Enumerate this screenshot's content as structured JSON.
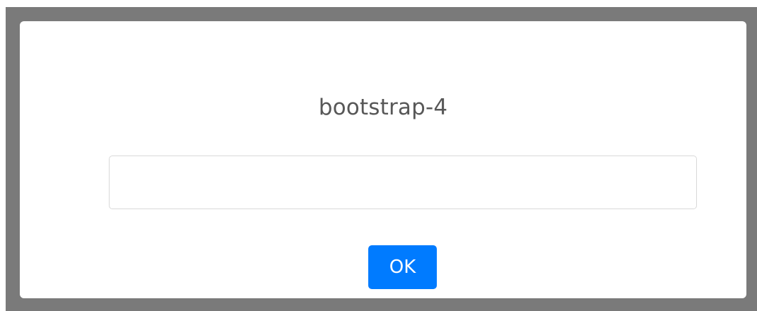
{
  "dialog": {
    "title": "bootstrap-4",
    "input": {
      "value": "",
      "placeholder": ""
    },
    "ok_label": "OK"
  },
  "colors": {
    "backdrop": "#7a7a7a",
    "modal_background": "#ffffff",
    "title_text": "#575757",
    "input_border": "#d9d9d9",
    "ok_button_background": "#007bff",
    "ok_button_text": "#ffffff"
  }
}
